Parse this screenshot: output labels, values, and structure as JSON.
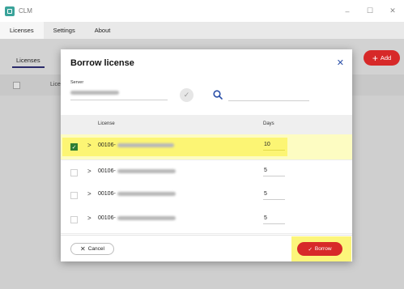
{
  "window": {
    "title": "CLM",
    "controls": {
      "minimize": "–",
      "maximize": "☐",
      "close": "✕"
    }
  },
  "menu": {
    "tabs": [
      "Licenses",
      "Settings",
      "About"
    ]
  },
  "page": {
    "subtab": "Licenses",
    "add_label": "Add",
    "table_column": "License"
  },
  "dialog": {
    "title": "Borrow license",
    "close_glyph": "✕",
    "server_label": "Server",
    "columns": {
      "license": "License",
      "days": "Days"
    },
    "rows": [
      {
        "prefix": "00106-",
        "days": "10",
        "checked": true
      },
      {
        "prefix": "00106-",
        "days": "5",
        "checked": false
      },
      {
        "prefix": "00106-",
        "days": "5",
        "checked": false
      },
      {
        "prefix": "00106-",
        "days": "5",
        "checked": false
      }
    ],
    "cancel_label": "Cancel",
    "borrow_label": "Borrow"
  },
  "colors": {
    "accent_red": "#d72929",
    "check_green": "#2e7d32",
    "highlight_yellow": "#fbf35a",
    "link_blue": "#2a4fa8"
  },
  "icons": [
    "app-icon",
    "close-icon",
    "check-circle-icon",
    "search-icon",
    "chevron-right-icon",
    "plus-icon",
    "check-icon"
  ]
}
